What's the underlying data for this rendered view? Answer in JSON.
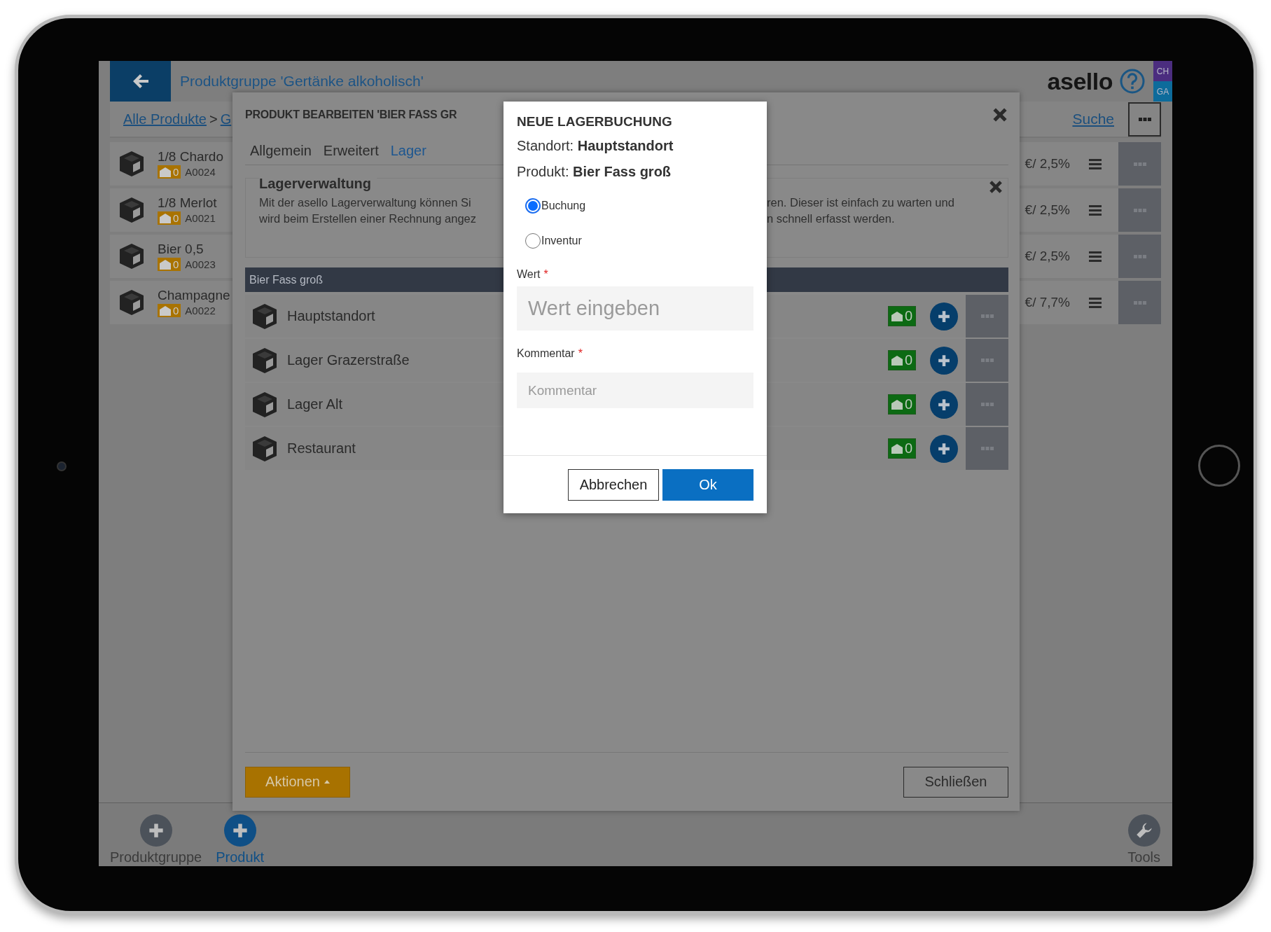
{
  "header": {
    "title": "Produktgruppe 'Gertänke alkoholisch'",
    "logo": "asello",
    "user_badges": [
      {
        "text": "CH",
        "color": "#4b2d7f"
      },
      {
        "text": "GA",
        "color": "#0d6b9b"
      }
    ]
  },
  "breadcrumb": {
    "items": [
      "Alle Produkte",
      "G"
    ],
    "separator": ">",
    "search_link": "Suche"
  },
  "products": [
    {
      "name": "1/8 Chardo",
      "stock": "0",
      "code": "A0024",
      "price": "€/ 2,5%"
    },
    {
      "name": "1/8 Merlot",
      "stock": "0",
      "code": "A0021",
      "price": "€/ 2,5%"
    },
    {
      "name": "Bier 0,5",
      "stock": "0",
      "code": "A0023",
      "price": "€/ 2,5%"
    },
    {
      "name": "Champagne",
      "stock": "0",
      "code": "A0022",
      "price": "€/ 7,7%"
    }
  ],
  "product_modal": {
    "title": "PRODUKT BEARBEITEN 'BIER FASS GR",
    "tabs": [
      {
        "label": "Allgemein",
        "selected": false
      },
      {
        "label": "Erweitert",
        "selected": false
      },
      {
        "label": "Lager",
        "selected": true
      }
    ],
    "info": {
      "title": "Lagerverwaltung",
      "lines_left": [
        "Mit der asello Lagerverwaltung können Si",
        "wird beim Erstellen einer Rechnung angez"
      ],
      "lines_right": [
        "ren. Dieser ist einfach zu warten und",
        "n schnell erfasst werden."
      ]
    },
    "section_title": "Bier Fass groß",
    "locations": [
      {
        "name": "Hauptstandort",
        "stock": "0"
      },
      {
        "name": "Lager Grazerstraße",
        "stock": "0"
      },
      {
        "name": "Lager Alt",
        "stock": "0"
      },
      {
        "name": "Restaurant",
        "stock": "0"
      }
    ],
    "actions_button": "Aktionen",
    "close_button": "Schließen"
  },
  "dialog": {
    "title": "NEUE LAGERBUCHUNG",
    "details": [
      {
        "label": "Standort:",
        "value": "Hauptstandort"
      },
      {
        "label": "Produkt:",
        "value": "Bier Fass groß"
      }
    ],
    "options": [
      {
        "label": "Buchung",
        "selected": true
      },
      {
        "label": "Inventur",
        "selected": false
      }
    ],
    "fields": [
      {
        "kind": "large",
        "label": "Wert",
        "required_mark": "*",
        "placeholder": "Wert eingeben"
      },
      {
        "kind": "normal",
        "label": "Kommentar",
        "required_mark": "*",
        "placeholder": "Kommentar"
      }
    ],
    "cancel_button": "Abbrechen",
    "ok_button": "Ok"
  },
  "bottom_nav": [
    {
      "kind": "plus",
      "label": "Produktgruppe",
      "selected": false
    },
    {
      "kind": "plus",
      "label": "Produkt",
      "selected": true
    },
    {
      "kind": "wrench",
      "label": "Tools",
      "selected": false
    }
  ]
}
